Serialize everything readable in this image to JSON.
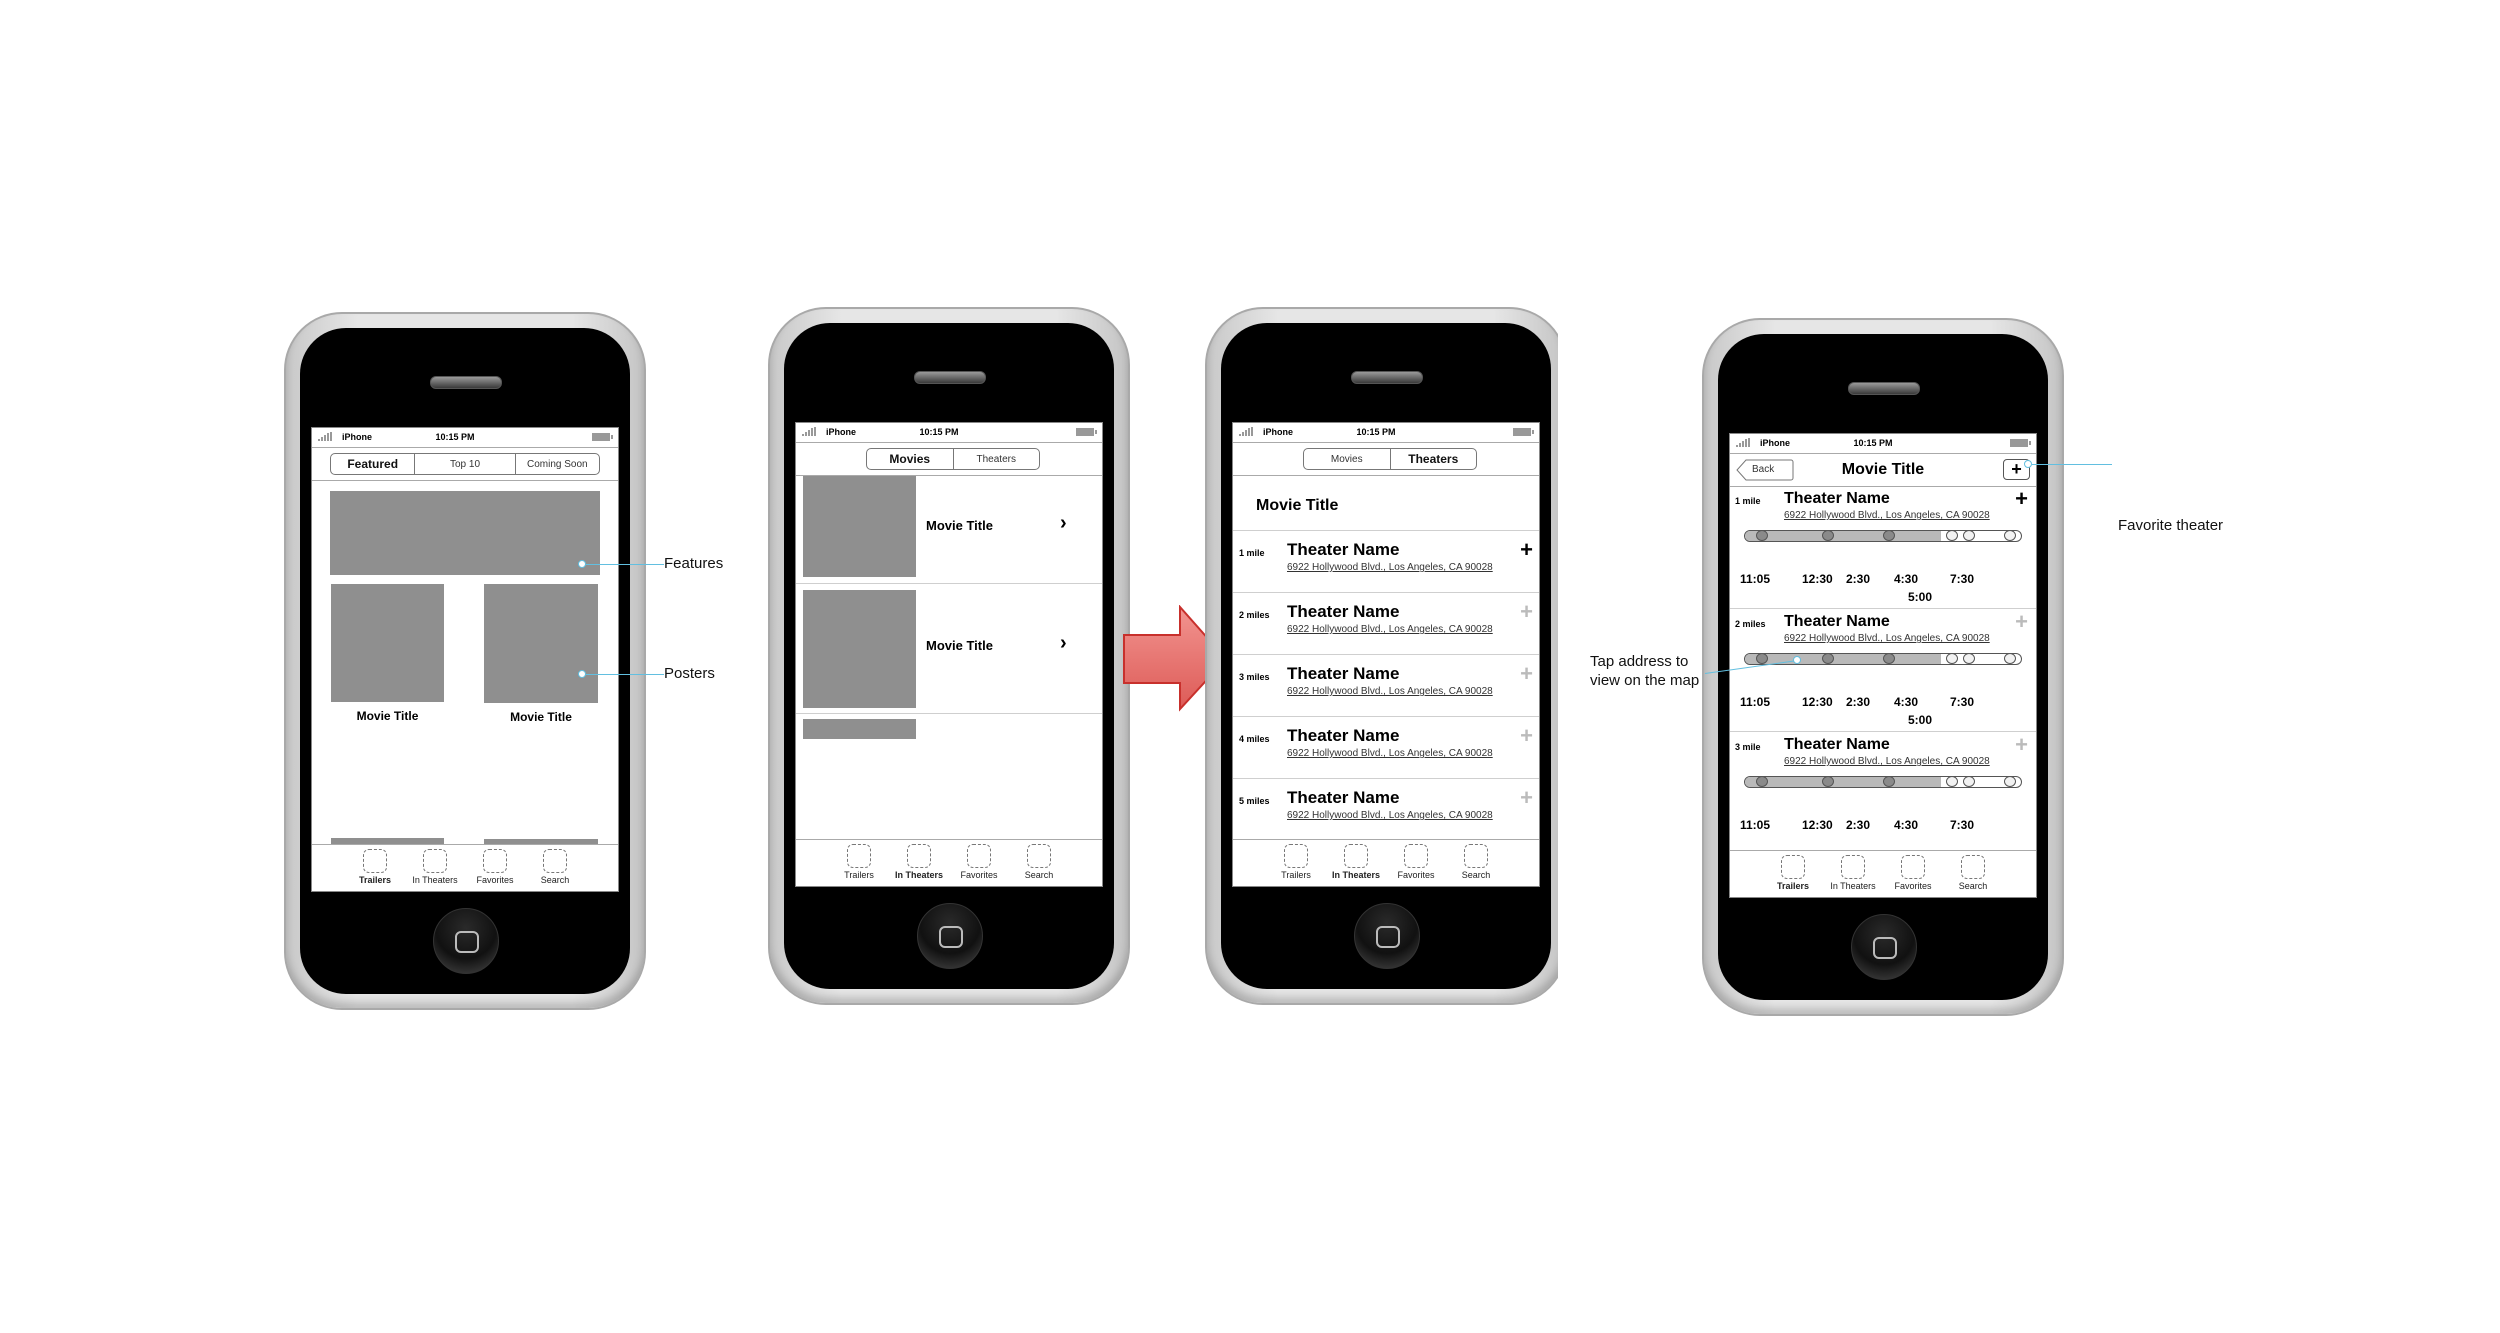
{
  "status_bar": {
    "carrier": "iPhone",
    "time": "10:15 PM"
  },
  "tab_bar": [
    "Trailers",
    "In Theaters",
    "Favorites",
    "Search"
  ],
  "annotation_color": "#62bfe0",
  "arrow_color": "#e8706c",
  "screen1": {
    "segments": [
      "Featured",
      "Top 10",
      "Coming Soon"
    ],
    "active_segment": "Featured",
    "posters": [
      {
        "title": "Movie Title"
      },
      {
        "title": "Movie Title"
      }
    ],
    "active_tab": "Trailers",
    "annotations": {
      "features": "Features",
      "posters": "Posters"
    }
  },
  "screen2": {
    "segments": [
      "Movies",
      "Theaters"
    ],
    "active_segment": "Movies",
    "movies": [
      {
        "title": "Movie Title"
      },
      {
        "title": "Movie Title"
      }
    ],
    "active_tab": "In Theaters"
  },
  "screen3": {
    "segments": [
      "Movies",
      "Theaters"
    ],
    "active_segment": "Theaters",
    "movie_title": "Movie Title",
    "theaters": [
      {
        "distance": "1 mile",
        "name": "Theater Name",
        "address": "6922 Hollywood Blvd., Los Angeles, CA 90028",
        "favorite": true
      },
      {
        "distance": "2 miles",
        "name": "Theater Name",
        "address": "6922 Hollywood Blvd., Los Angeles, CA 90028",
        "favorite": false
      },
      {
        "distance": "3 miles",
        "name": "Theater Name",
        "address": "6922 Hollywood Blvd., Los Angeles, CA 90028",
        "favorite": false
      },
      {
        "distance": "4 miles",
        "name": "Theater Name",
        "address": "6922 Hollywood Blvd., Los Angeles, CA 90028",
        "favorite": false
      },
      {
        "distance": "5 miles",
        "name": "Theater Name",
        "address": "6922 Hollywood Blvd., Los Angeles, CA 90028",
        "favorite": false
      }
    ],
    "active_tab": "In Theaters"
  },
  "screen4": {
    "back_label": "Back",
    "title": "Movie Title",
    "add_label": "+",
    "theaters": [
      {
        "distance": "1 mile",
        "name": "Theater Name",
        "address": "6922 Hollywood Blvd., Los Angeles, CA 90028",
        "favorite": true,
        "times_row1": [
          "11:05",
          "12:30",
          "2:30",
          "4:30",
          "7:30"
        ],
        "times_row2": "5:00"
      },
      {
        "distance": "2 miles",
        "name": "Theater Name",
        "address": "6922 Hollywood Blvd., Los Angeles, CA 90028",
        "favorite": false,
        "times_row1": [
          "11:05",
          "12:30",
          "2:30",
          "4:30",
          "7:30"
        ],
        "times_row2": "5:00"
      },
      {
        "distance": "3 mile",
        "name": "Theater Name",
        "address": "6922 Hollywood Blvd., Los Angeles, CA 90028",
        "favorite": false,
        "times_row1": [
          "11:05",
          "12:30",
          "2:30",
          "4:30",
          "7:30"
        ],
        "times_row2": ""
      }
    ],
    "timeline_past_fraction": 0.71,
    "active_tab": "Trailers",
    "annotations": {
      "favorite": "Favorite theater",
      "address_line1": "Tap address to",
      "address_line2": "view on the map"
    }
  }
}
